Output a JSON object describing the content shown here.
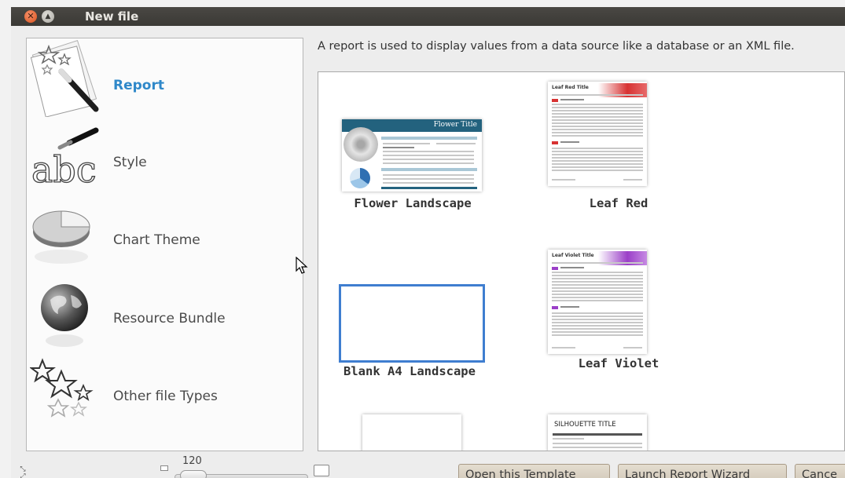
{
  "window": {
    "title": "New file"
  },
  "categories": [
    {
      "label": "Report",
      "icon": "report-wand-icon",
      "selected": true
    },
    {
      "label": "Style",
      "icon": "style-abc-icon",
      "selected": false
    },
    {
      "label": "Chart Theme",
      "icon": "chart-theme-pie-icon",
      "selected": false
    },
    {
      "label": "Resource Bundle",
      "icon": "resource-bundle-globe-icon",
      "selected": false
    },
    {
      "label": "Other file Types",
      "icon": "other-file-types-stars-icon",
      "selected": false
    }
  ],
  "description": "A report is used to display values from a data source like a database or an XML file.",
  "templates": [
    {
      "name": "Flower Landscape",
      "thumb_title": "Flower Title"
    },
    {
      "name": "Leaf Red",
      "thumb_title": "Leaf Red Title"
    },
    {
      "name": "Blank A4 Landscape"
    },
    {
      "name": "Leaf Violet",
      "thumb_title": "Leaf Violet Title"
    },
    {
      "name": "",
      "thumb_title": ""
    },
    {
      "name": "",
      "thumb_title": "SILHOUETTE TITLE"
    }
  ],
  "zoom": {
    "value": "120"
  },
  "buttons": {
    "open_template": "Open this Template",
    "launch_wizard": "Launch Report Wizard",
    "cancel": "Cance"
  },
  "colors": {
    "accent": "#2f88c9",
    "selection": "#3f7ed0",
    "titlebar": "#3c3b37"
  }
}
